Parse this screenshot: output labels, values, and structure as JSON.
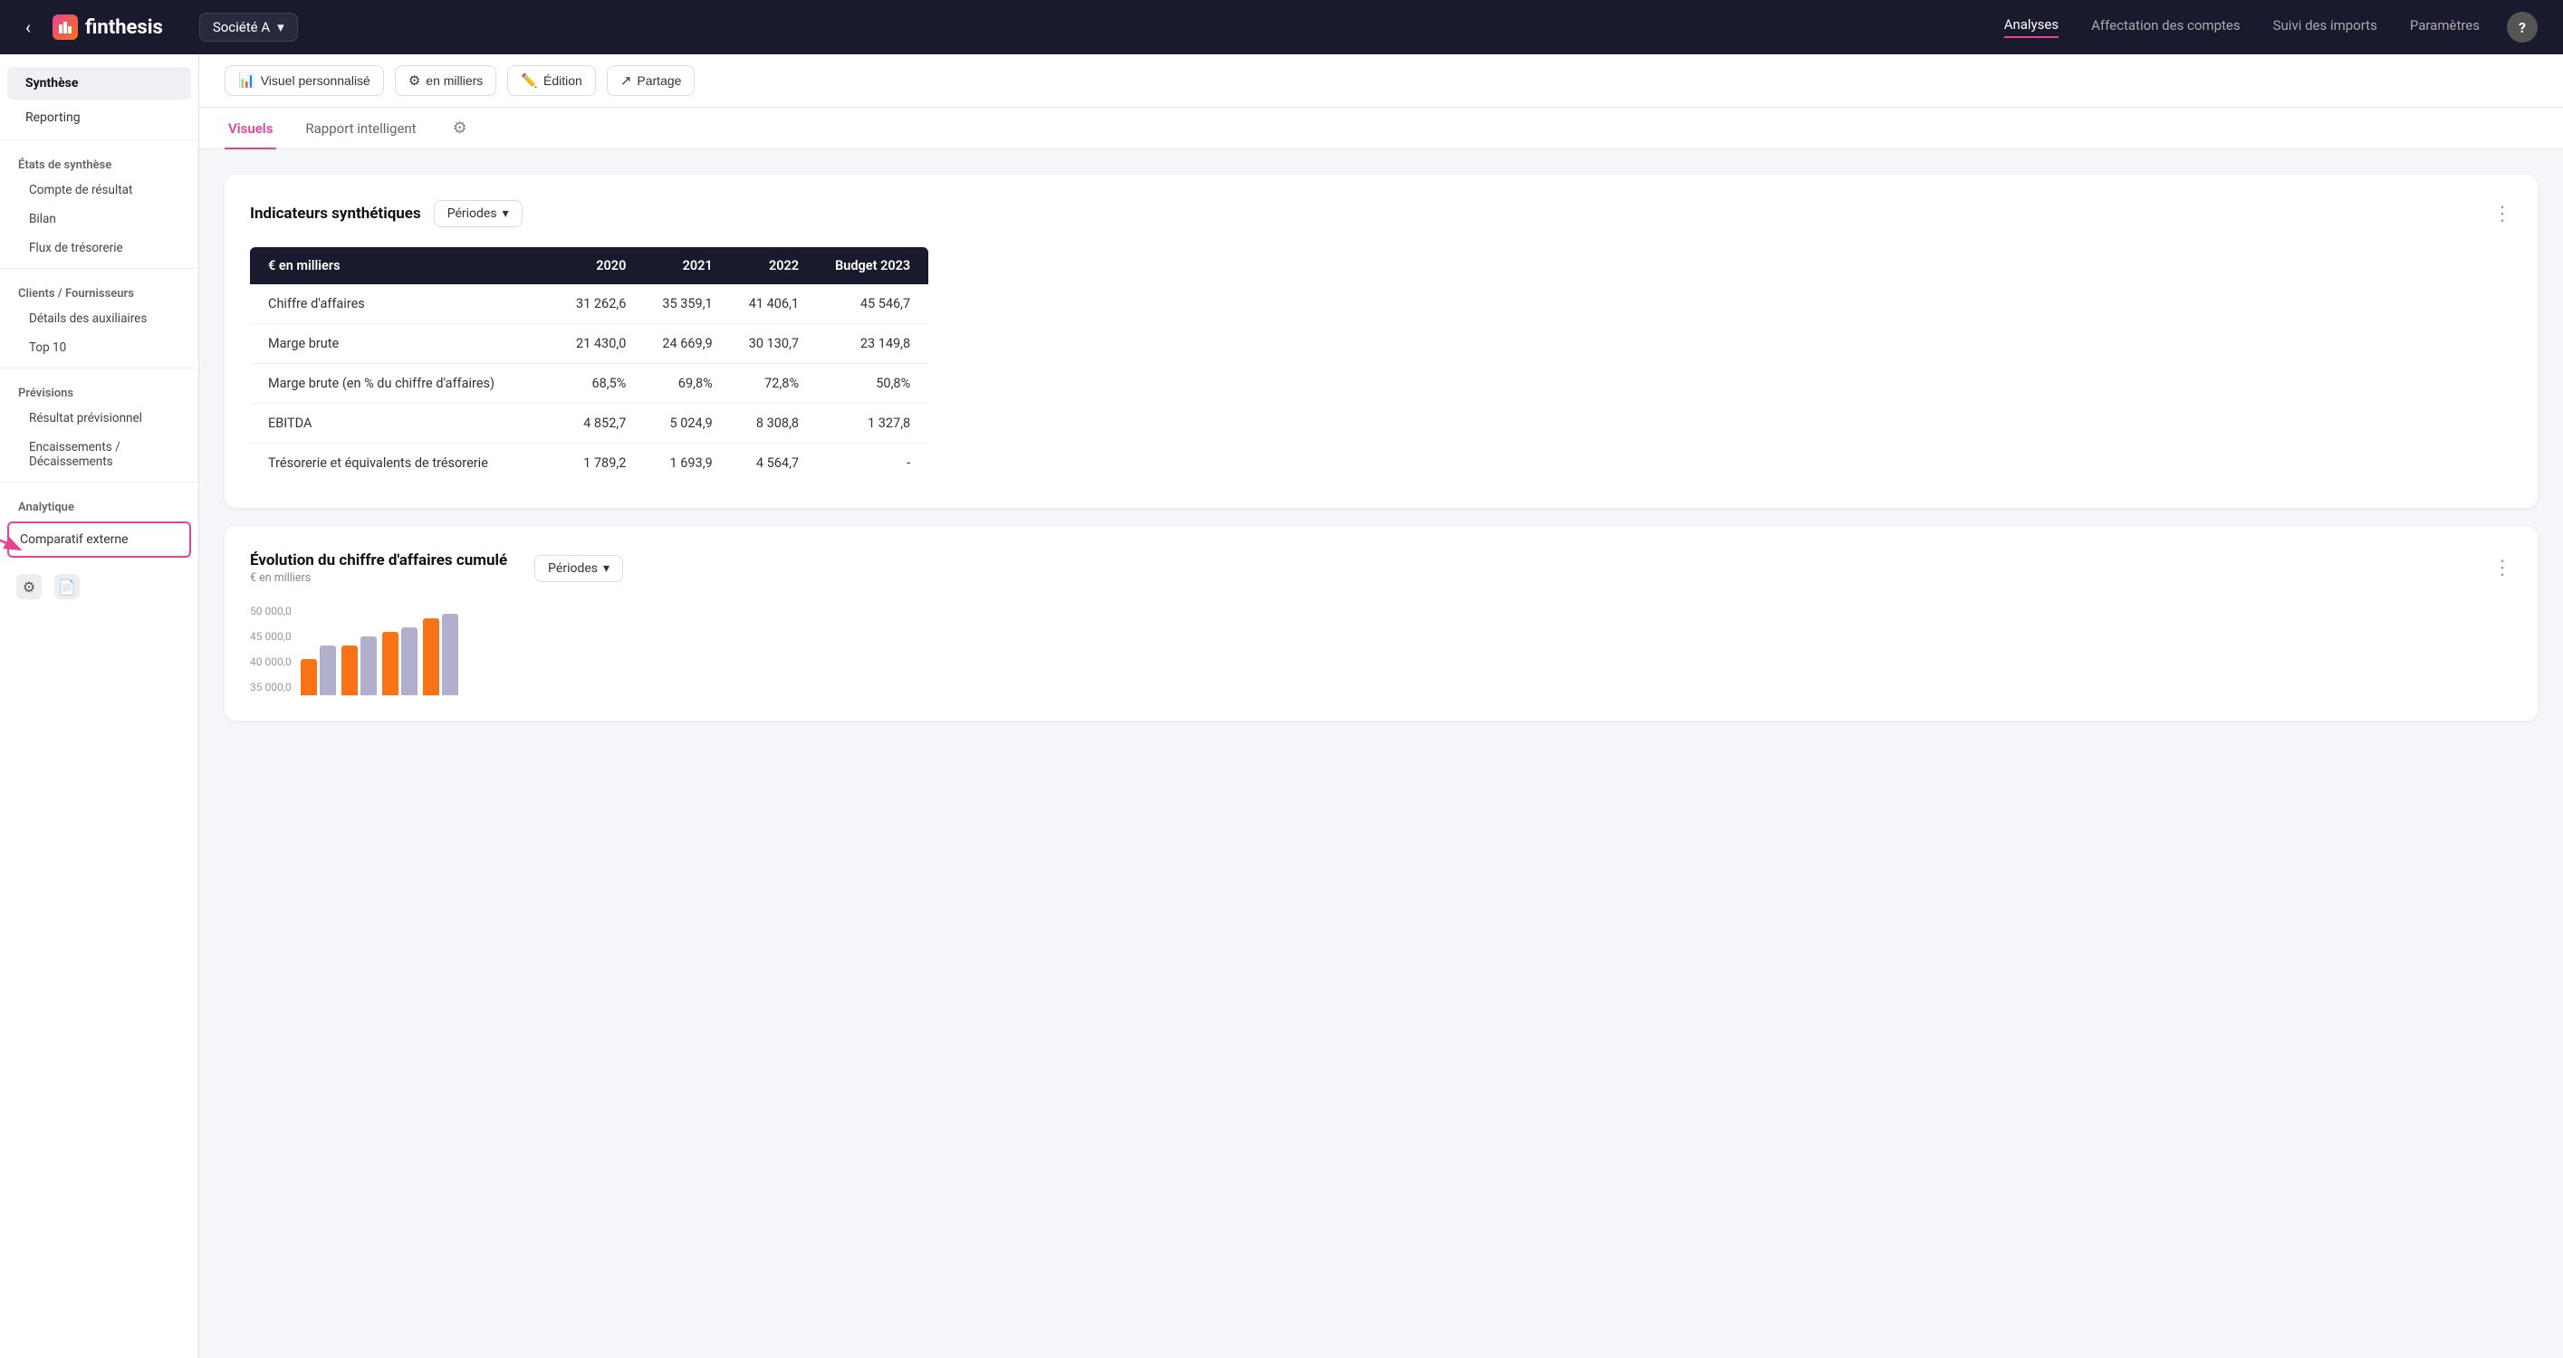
{
  "app": {
    "name": "finthesis",
    "back_label": "←",
    "help_label": "?"
  },
  "topnav": {
    "company": "Société A",
    "nav_items": [
      {
        "label": "Analyses",
        "active": true
      },
      {
        "label": "Affectation des comptes",
        "active": false
      },
      {
        "label": "Suivi des imports",
        "active": false
      },
      {
        "label": "Paramètres",
        "active": false
      }
    ]
  },
  "sidebar": {
    "items": [
      {
        "label": "Synthèse",
        "active": true,
        "type": "item"
      },
      {
        "label": "Reporting",
        "active": false,
        "type": "item"
      },
      {
        "label": "États de synthèse",
        "type": "section"
      },
      {
        "label": "Compte de résultat",
        "type": "subitem"
      },
      {
        "label": "Bilan",
        "type": "subitem"
      },
      {
        "label": "Flux de trésorerie",
        "type": "subitem"
      },
      {
        "label": "Clients / Fournisseurs",
        "type": "section"
      },
      {
        "label": "Détails des auxiliaires",
        "type": "subitem"
      },
      {
        "label": "Top 10",
        "type": "subitem"
      },
      {
        "label": "Prévisions",
        "type": "section"
      },
      {
        "label": "Résultat prévisionnel",
        "type": "subitem"
      },
      {
        "label": "Encaissements / Décaissements",
        "type": "subitem"
      },
      {
        "label": "Analytique",
        "type": "section"
      },
      {
        "label": "Comparatif externe",
        "type": "highlighted"
      }
    ],
    "bottom_icons": [
      "⚙",
      "📄"
    ]
  },
  "toolbar": {
    "buttons": [
      {
        "id": "visuel",
        "icon": "📊",
        "label": "Visuel personnalisé"
      },
      {
        "id": "milliers",
        "icon": "⚙",
        "label": "en milliers"
      },
      {
        "id": "edition",
        "icon": "✏️",
        "label": "Édition"
      },
      {
        "id": "partage",
        "icon": "↗",
        "label": "Partage"
      }
    ]
  },
  "tabs": {
    "items": [
      {
        "label": "Visuels",
        "active": true
      },
      {
        "label": "Rapport intelligent",
        "active": false
      }
    ]
  },
  "indicators_card": {
    "title": "Indicateurs synthétiques",
    "periodes_label": "Périodes",
    "table": {
      "columns": [
        "€ en milliers",
        "2020",
        "2021",
        "2022",
        "Budget 2023"
      ],
      "rows": [
        {
          "label": "Chiffre d'affaires",
          "values": [
            "31 262,6",
            "35 359,1",
            "41 406,1",
            "45 546,7"
          ]
        },
        {
          "label": "Marge brute",
          "values": [
            "21 430,0",
            "24 669,9",
            "30 130,7",
            "23 149,8"
          ]
        },
        {
          "label": "Marge brute (en % du chiffre d'affaires)",
          "values": [
            "68,5%",
            "69,8%",
            "72,8%",
            "50,8%"
          ]
        },
        {
          "label": "EBITDA",
          "values": [
            "4 852,7",
            "5 024,9",
            "8 308,8",
            "1 327,8"
          ]
        },
        {
          "label": "Trésorerie et équivalents de trésorerie",
          "values": [
            "1 789,2",
            "1 693,9",
            "4 564,7",
            "-"
          ]
        }
      ]
    }
  },
  "chart_card": {
    "title": "Évolution du chiffre d'affaires cumulé",
    "subtitle": "€ en milliers",
    "periodes_label": "Périodes",
    "y_labels": [
      "50 000,0",
      "45 000,0",
      "40 000,0",
      "35 000,0"
    ],
    "bars": [
      {
        "color1": "#f97316",
        "color2": "#a0a0c0",
        "h1": 40,
        "h2": 55
      },
      {
        "color1": "#f97316",
        "color2": "#a0a0c0",
        "h1": 55,
        "h2": 65
      },
      {
        "color1": "#f97316",
        "color2": "#a0a0c0",
        "h1": 70,
        "h2": 75
      },
      {
        "color1": "#f97316",
        "color2": "#a0a0c0",
        "h1": 85,
        "h2": 90
      }
    ]
  }
}
